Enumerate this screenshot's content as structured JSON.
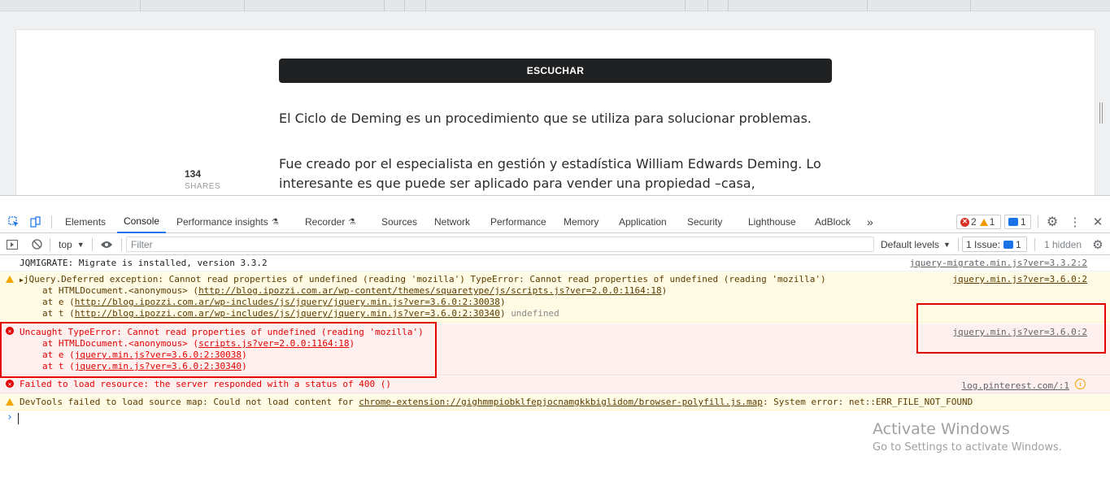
{
  "page": {
    "listen_button": "ESCUCHAR",
    "paragraph_1": "El Ciclo de Deming es un procedimiento que se utiliza para solucionar problemas.",
    "paragraph_2_line_1": "Fue creado por el especialista en gestión y estadística William Edwards Deming. Lo",
    "paragraph_2_line_2": "interesante es que puede ser aplicado para vender una propiedad –casa, departamento,",
    "shares_count": "134",
    "shares_label": "SHARES"
  },
  "devtools": {
    "tabs": [
      "Elements",
      "Console",
      "Performance insights",
      "Recorder",
      "Sources",
      "Network",
      "Performance",
      "Memory",
      "Application",
      "Security",
      "Lighthouse",
      "AdBlock"
    ],
    "more_tabs": "»",
    "error_count": "2",
    "warning_count": "1",
    "message_count": "1",
    "context": "top",
    "filter_placeholder": "Filter",
    "default_levels": "Default levels",
    "issues_label": "1 Issue:",
    "issues_count": "1",
    "hidden_label": "1 hidden"
  },
  "console": {
    "messages": [
      {
        "level": "info",
        "lines": [
          "JQMIGRATE: Migrate is installed, version 3.3.2"
        ],
        "source": "jquery-migrate.min.js?ver=3.3.2:2"
      },
      {
        "level": "warning",
        "line1": "jQuery.Deferred exception: Cannot read properties of undefined (reading 'mozilla') TypeError: Cannot read properties of undefined (reading 'mozilla')",
        "line2_prefix": "at HTMLDocument.<anonymous> (",
        "line2_link": "http://blog.ipozzi.com.ar/wp-content/themes/squaretype/js/scripts.js?ver=2.0.0:1164:18",
        "line3_prefix": "at e (",
        "line3_link": "http://blog.ipozzi.com.ar/wp-includes/js/jquery/jquery.min.js?ver=3.6.0:2:30038",
        "line4_prefix": "at t (",
        "line4_link": "http://blog.ipozzi.com.ar/wp-includes/js/jquery/jquery.min.js?ver=3.6.0:2:30340",
        "line4_suffix": "undefined",
        "source": "jquery.min.js?ver=3.6.0:2"
      },
      {
        "level": "error",
        "line1": "Uncaught TypeError: Cannot read properties of undefined (reading 'mozilla')",
        "line2_prefix": "at HTMLDocument.<anonymous> (",
        "line2_link": "scripts.js?ver=2.0.0:1164:18",
        "line3_prefix": "at e (",
        "line3_link": "jquery.min.js?ver=3.6.0:2:30038",
        "line4_prefix": "at t (",
        "line4_link": "jquery.min.js?ver=3.6.0:2:30340",
        "source": "jquery.min.js?ver=3.6.0:2"
      },
      {
        "level": "error",
        "line1": "Failed to load resource: the server responded with a status of 400 ()",
        "source": "log.pinterest.com/:1"
      },
      {
        "level": "warning",
        "line1_prefix": "DevTools failed to load source map: Could not load content for ",
        "line1_link": "chrome-extension://gighmmpiobklfepjocnamgkkbiglidom/browser-polyfill.js.map",
        "line1_suffix": ": System error: net::ERR_FILE_NOT_FOUND"
      }
    ],
    "prompt": "›"
  },
  "watermark": {
    "title": "Activate Windows",
    "subtitle": "Go to Settings to activate Windows."
  },
  "colors": {
    "accent": "#1a73e8",
    "error": "#e20000",
    "warning_bg": "#fffbe5",
    "error_bg": "#fff0f0",
    "annotation": "#e50000"
  }
}
